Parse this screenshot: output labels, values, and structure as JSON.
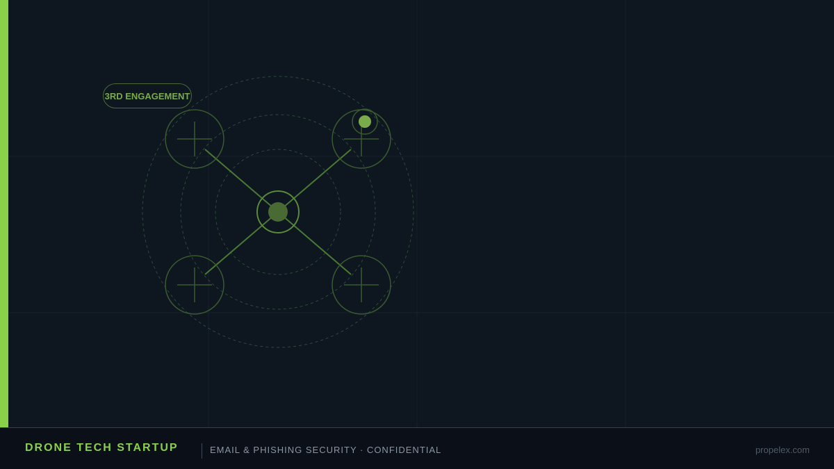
{
  "colors": {
    "accent": "#8ad14a",
    "badge_text": "#7aab4a",
    "drone_line": "#4a7a34",
    "drone_dim": "#3a5a30",
    "ring": "#2d4a3a",
    "background": "#0e1620",
    "footer_bg": "#0b0f17"
  },
  "badge": {
    "label": "3RD ENGAGEMENT"
  },
  "footer": {
    "brand": "DRONE TECH STARTUP",
    "subtitle": "EMAIL & PHISHING SECURITY · CONFIDENTIAL",
    "site": "propelex.com"
  },
  "icons": {
    "drone": "drone-icon",
    "rotor": "rotor-icon",
    "status_dot": "status-dot-icon"
  }
}
